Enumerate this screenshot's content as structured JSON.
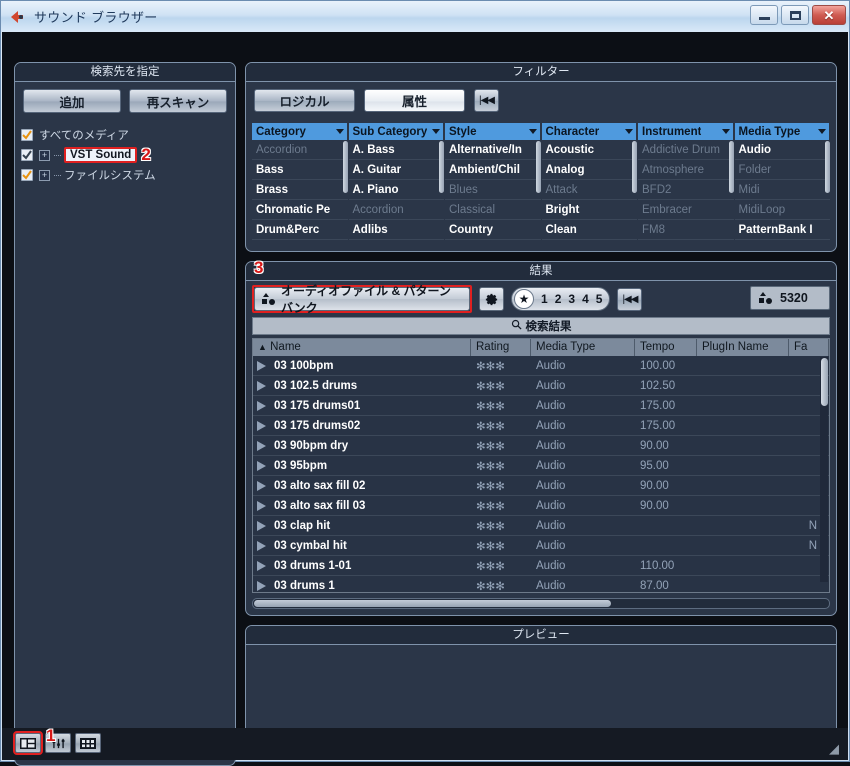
{
  "window": {
    "title": "サウンド ブラウザー",
    "icon": "cubase-logo-icon",
    "minimize_label": "",
    "maximize_label": "",
    "close_label": "✕"
  },
  "left_panel": {
    "header": "検索先を指定",
    "buttons": {
      "add": "追加",
      "rescan": "再スキャン"
    },
    "tree": [
      {
        "label": "すべてのメディア",
        "checked": true,
        "selected": false,
        "expandable": false,
        "indent": 0
      },
      {
        "label": "VST Sound",
        "checked": true,
        "selected": true,
        "expandable": true,
        "indent": 1,
        "annotation": "2"
      },
      {
        "label": "ファイルシステム",
        "checked": true,
        "selected": false,
        "expandable": true,
        "indent": 1
      }
    ]
  },
  "filter_panel": {
    "header": "フィルター",
    "buttons": {
      "logical": "ロジカル",
      "attribute": "属性",
      "reset": "|◀◀"
    },
    "active_button": "属性",
    "columns": [
      {
        "header": "Category",
        "items": [
          {
            "label": "Accordion",
            "enabled": false
          },
          {
            "label": "Bass",
            "enabled": true
          },
          {
            "label": "Brass",
            "enabled": true
          },
          {
            "label": "Chromatic Pe",
            "enabled": true
          },
          {
            "label": "Drum&Perc",
            "enabled": true
          }
        ]
      },
      {
        "header": "Sub Category",
        "items": [
          {
            "label": "A. Bass",
            "enabled": true
          },
          {
            "label": "A. Guitar",
            "enabled": true
          },
          {
            "label": "A. Piano",
            "enabled": true
          },
          {
            "label": "Accordion",
            "enabled": false
          },
          {
            "label": "Adlibs",
            "enabled": true
          }
        ]
      },
      {
        "header": "Style",
        "items": [
          {
            "label": "Alternative/In",
            "enabled": true
          },
          {
            "label": "Ambient/Chil",
            "enabled": true
          },
          {
            "label": "Blues",
            "enabled": false
          },
          {
            "label": "Classical",
            "enabled": false
          },
          {
            "label": "Country",
            "enabled": true
          }
        ]
      },
      {
        "header": "Character",
        "items": [
          {
            "label": "Acoustic",
            "enabled": true
          },
          {
            "label": "Analog",
            "enabled": true
          },
          {
            "label": "Attack",
            "enabled": false
          },
          {
            "label": "Bright",
            "enabled": true
          },
          {
            "label": "Clean",
            "enabled": true
          }
        ]
      },
      {
        "header": "Instrument",
        "items": [
          {
            "label": "Addictive Drum",
            "enabled": false
          },
          {
            "label": "Atmosphere",
            "enabled": false
          },
          {
            "label": "BFD2",
            "enabled": false
          },
          {
            "label": "Embracer",
            "enabled": false
          },
          {
            "label": "FM8",
            "enabled": false
          }
        ]
      },
      {
        "header": "Media Type",
        "items": [
          {
            "label": "Audio",
            "enabled": true
          },
          {
            "label": "Folder",
            "enabled": false
          },
          {
            "label": "Midi",
            "enabled": false
          },
          {
            "label": "MidiLoop",
            "enabled": false
          },
          {
            "label": "PatternBank I",
            "enabled": true
          }
        ]
      }
    ]
  },
  "results_panel": {
    "header": "結果",
    "annotation": "3",
    "filter_select": "オーディオファイル & パターンバンク",
    "settings_icon": "gear-icon",
    "rating_star": "★",
    "rating_values": [
      "1",
      "2",
      "3",
      "4",
      "5"
    ],
    "reset_label": "|◀◀",
    "count": "5320",
    "search_label": "検索結果",
    "search_icon": "magnifier-icon",
    "columns": [
      "Name",
      "Rating",
      "Media Type",
      "Tempo",
      "PlugIn Name",
      "Fa"
    ],
    "sort_indicator": "▲",
    "rows": [
      {
        "name": "03 100bpm",
        "rating": "✻✻✻",
        "media_type": "Audio",
        "tempo": "100.00",
        "plugin": "",
        "family": ""
      },
      {
        "name": "03 102.5 drums",
        "rating": "✻✻✻",
        "media_type": "Audio",
        "tempo": "102.50",
        "plugin": "",
        "family": ""
      },
      {
        "name": "03 175 drums01",
        "rating": "✻✻✻",
        "media_type": "Audio",
        "tempo": "175.00",
        "plugin": "",
        "family": ""
      },
      {
        "name": "03 175 drums02",
        "rating": "✻✻✻",
        "media_type": "Audio",
        "tempo": "175.00",
        "plugin": "",
        "family": ""
      },
      {
        "name": "03 90bpm dry",
        "rating": "✻✻✻",
        "media_type": "Audio",
        "tempo": "90.00",
        "plugin": "",
        "family": ""
      },
      {
        "name": "03 95bpm",
        "rating": "✻✻✻",
        "media_type": "Audio",
        "tempo": "95.00",
        "plugin": "",
        "family": ""
      },
      {
        "name": "03 alto sax fill 02",
        "rating": "✻✻✻",
        "media_type": "Audio",
        "tempo": "90.00",
        "plugin": "",
        "family": ""
      },
      {
        "name": "03 alto sax fill 03",
        "rating": "✻✻✻",
        "media_type": "Audio",
        "tempo": "90.00",
        "plugin": "",
        "family": ""
      },
      {
        "name": "03 clap hit",
        "rating": "✻✻✻",
        "media_type": "Audio",
        "tempo": "",
        "plugin": "",
        "family": "N"
      },
      {
        "name": "03 cymbal hit",
        "rating": "✻✻✻",
        "media_type": "Audio",
        "tempo": "",
        "plugin": "",
        "family": "N"
      },
      {
        "name": "03 drums 1-01",
        "rating": "✻✻✻",
        "media_type": "Audio",
        "tempo": "110.00",
        "plugin": "",
        "family": ""
      },
      {
        "name": "03 drums 1",
        "rating": "✻✻✻",
        "media_type": "Audio",
        "tempo": "87.00",
        "plugin": "",
        "family": ""
      }
    ]
  },
  "preview_panel": {
    "header": "プレビュー"
  },
  "bottom_bar": {
    "view_buttons": [
      {
        "name": "split-view",
        "selected": true,
        "annotation": "1"
      },
      {
        "name": "settings-view",
        "selected": false
      },
      {
        "name": "grid-view",
        "selected": false
      }
    ],
    "resize_grip": "◢"
  },
  "colors": {
    "accent_blue": "#4f9ade",
    "panel_bg": "#2b3648",
    "panel_border": "#7f93ab",
    "annotation_red": "#e02020",
    "title_text": "#203a5c"
  }
}
